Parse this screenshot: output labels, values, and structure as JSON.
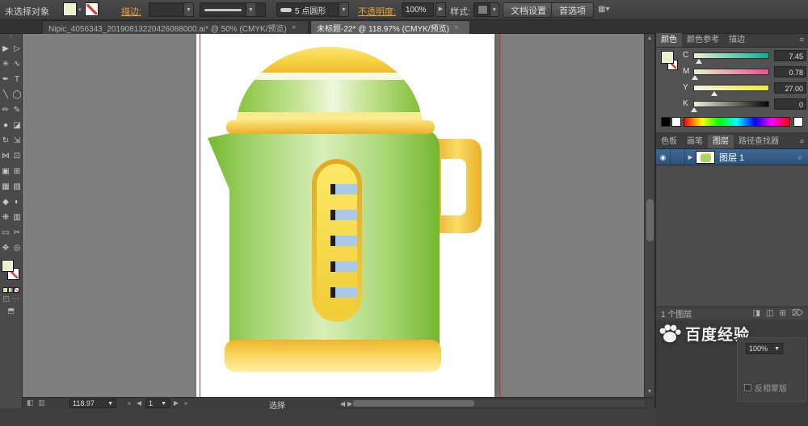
{
  "icons": {
    "chevron_down": "▼",
    "chevron_small": "▾",
    "close": "×",
    "menu": "≡",
    "eye": "◉",
    "target": "○",
    "arrow_left": "◀",
    "arrow_right": "▶",
    "arrow_up": "▲",
    "arrow_down": "▼",
    "first": "«",
    "last": "»",
    "expand": "▶",
    "grip": "⠿",
    "new_layer": "⊞",
    "new_sublayer": "◫",
    "clip_mask": "◨",
    "delete": "⌦",
    "workspace": "▦▾",
    "window_a": "◧",
    "window_b": "▥",
    "screen_mode": "⬒",
    "draw_modes": "◰ ⋯"
  },
  "top_bar": {
    "no_selection": "未选择对象",
    "stroke_label": "描边:",
    "brush_value": "5 点圆形",
    "opacity_label": "不透明度:",
    "opacity_value": "100%",
    "style_label": "样式:",
    "doc_setup": "文档设置",
    "preferences": "首选项"
  },
  "document_tabs": [
    {
      "title": "Nipic_4056343_20190813220426088000.ai* @ 50% (CMYK/预览)",
      "active": false
    },
    {
      "title": "未标题-22* @ 118.97% (CMYK/预览)",
      "active": true
    }
  ],
  "toolbar": {
    "tools": [
      {
        "name": "selection-tool",
        "glyph": "▶"
      },
      {
        "name": "direct-selection-tool",
        "glyph": "▷"
      },
      {
        "name": "magic-wand-tool",
        "glyph": "✳"
      },
      {
        "name": "lasso-tool",
        "glyph": "∿"
      },
      {
        "name": "pen-tool",
        "glyph": "✒"
      },
      {
        "name": "type-tool",
        "glyph": "T"
      },
      {
        "name": "line-segment-tool",
        "glyph": "╲"
      },
      {
        "name": "ellipse-tool",
        "glyph": "◯"
      },
      {
        "name": "paintbrush-tool",
        "glyph": "✏"
      },
      {
        "name": "pencil-tool",
        "glyph": "✎"
      },
      {
        "name": "blob-brush-tool",
        "glyph": "●"
      },
      {
        "name": "eraser-tool",
        "glyph": "◪"
      },
      {
        "name": "rotate-tool",
        "glyph": "↻"
      },
      {
        "name": "scale-tool",
        "glyph": "⇲"
      },
      {
        "name": "width-tool",
        "glyph": "⋈"
      },
      {
        "name": "free-transform-tool",
        "glyph": "⊡"
      },
      {
        "name": "shape-builder-tool",
        "glyph": "▣"
      },
      {
        "name": "perspective-grid-tool",
        "glyph": "⊞"
      },
      {
        "name": "mesh-tool",
        "glyph": "▦"
      },
      {
        "name": "gradient-tool",
        "glyph": "▧"
      },
      {
        "name": "eyedropper-tool",
        "glyph": "◆"
      },
      {
        "name": "blend-tool",
        "glyph": "◐"
      },
      {
        "name": "symbol-sprayer-tool",
        "glyph": "❉"
      },
      {
        "name": "column-graph-tool",
        "glyph": "▥"
      },
      {
        "name": "artboard-tool",
        "glyph": "▭"
      },
      {
        "name": "slice-tool",
        "glyph": "✂"
      },
      {
        "name": "hand-tool",
        "glyph": "✥"
      },
      {
        "name": "zoom-tool",
        "glyph": "◎"
      }
    ]
  },
  "color_panel": {
    "tab_color": "颜色",
    "tab_color_guide": "颜色参考",
    "tab_stroke": "描边",
    "channels": [
      {
        "label": "C",
        "value": "7.45"
      },
      {
        "label": "M",
        "value": "0.78"
      },
      {
        "label": "Y",
        "value": "27.00"
      },
      {
        "label": "K",
        "value": "0"
      }
    ]
  },
  "layers_panel": {
    "tab_swatches": "色板",
    "tab_brushes": "画笔",
    "tab_layers": "图层",
    "tab_pathfinder": "路径查找器",
    "layer_name": "图层 1",
    "status": "1 个图层"
  },
  "status_bar": {
    "zoom": "118.97",
    "artboard_number": "1",
    "tool_status": "选择"
  },
  "watermark": {
    "text": "百度经验"
  },
  "transparency_fragment": {
    "opacity_value": "100%",
    "invert_mask": "反相蒙版"
  },
  "colors": {
    "link_orange": "#e9a43c",
    "fill_swatch": "#e7f3c4",
    "selection_blue": "#2f5578",
    "guide_red": "#b23b33",
    "kettle_green": "#8cc63f",
    "kettle_yellow": "#f7d24a",
    "gauge_blue": "#a9c9e9"
  }
}
